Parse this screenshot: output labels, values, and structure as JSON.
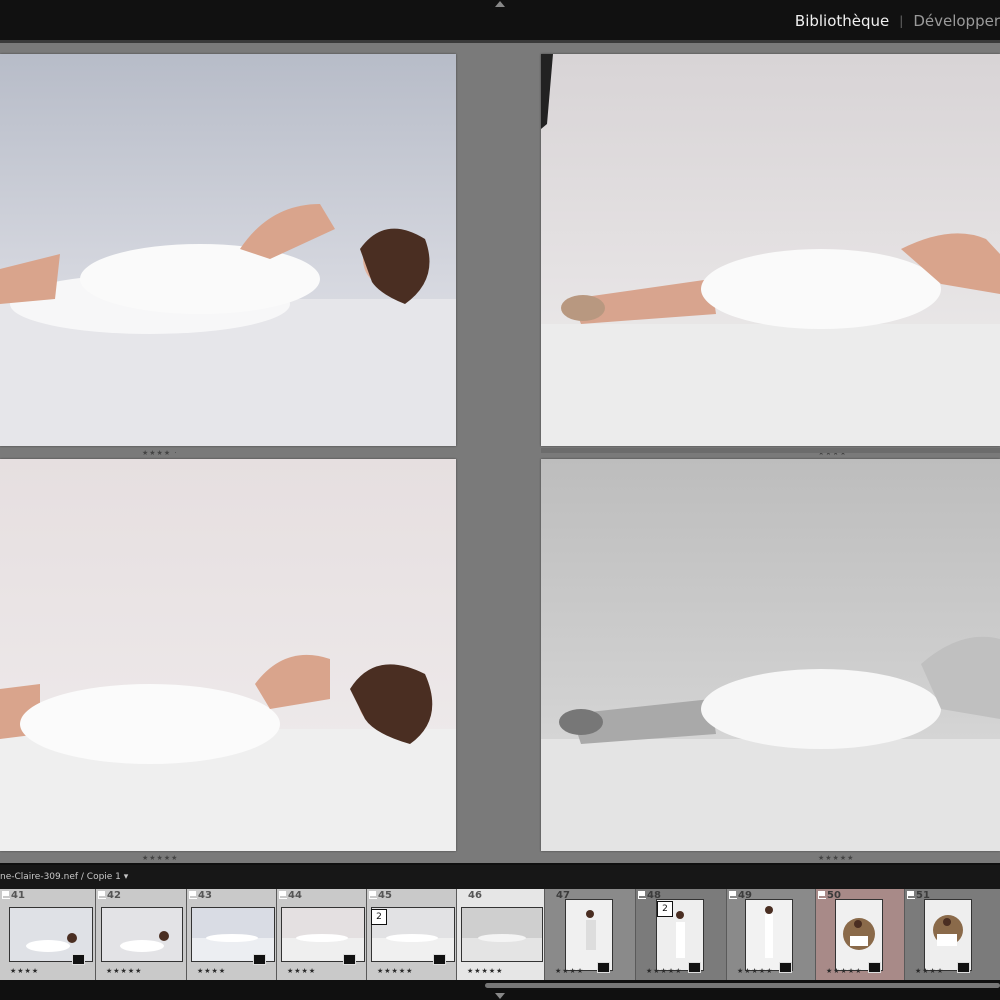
{
  "modules": {
    "active": "Bibliothèque",
    "separator": "|",
    "inactive": "Développer"
  },
  "compare": {
    "panes": [
      {
        "stars": "★★★★ ·"
      },
      {
        "stars": "★★★★ ·"
      },
      {
        "stars": "★★★★★"
      },
      {
        "stars": "★★★★★"
      }
    ]
  },
  "filmstrip": {
    "source": "ne-Claire-309.nef / Copie 1",
    "source_arrow": "▾",
    "cells": [
      {
        "num": "41",
        "stars": "★★★★"
      },
      {
        "num": "42",
        "stars": "★★★★★"
      },
      {
        "num": "43",
        "stars": "★★★★"
      },
      {
        "num": "44",
        "stars": "★★★★"
      },
      {
        "num": "45",
        "stars": "★★★★★",
        "stack": "2"
      },
      {
        "num": "46",
        "stars": "★★★★★"
      },
      {
        "num": "47",
        "stars": "★★★★"
      },
      {
        "num": "48",
        "stars": "★★★★★",
        "stack": "2"
      },
      {
        "num": "49",
        "stars": "★★★★★"
      },
      {
        "num": "50",
        "stars": "★★★★★"
      },
      {
        "num": "51",
        "stars": "★★★★"
      }
    ]
  },
  "colors": {
    "background": "#7a7a7a",
    "topbar": "#111111",
    "accent_text": "#f0f0f0"
  }
}
